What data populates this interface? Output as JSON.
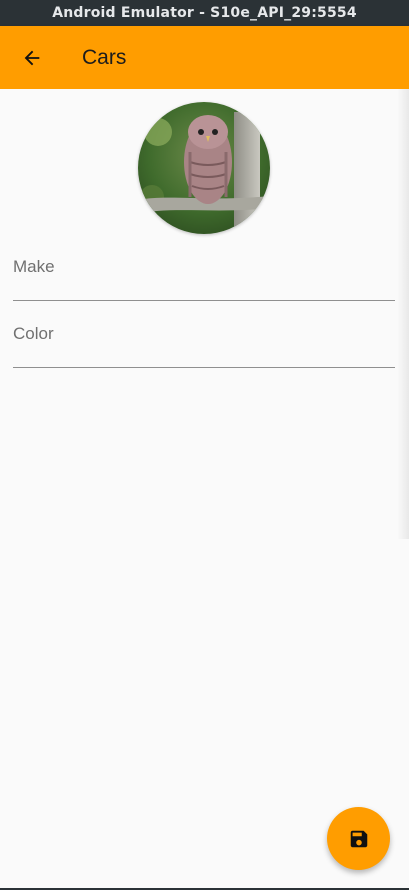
{
  "window": {
    "title": "Android Emulator - S10e_API_29:5554"
  },
  "app_bar": {
    "title": "Cars",
    "back_icon": "arrow-back-icon",
    "color": "#ff9d00"
  },
  "avatar": {
    "description": "owl-photo"
  },
  "form": {
    "make": {
      "label": "Make",
      "value": ""
    },
    "color": {
      "label": "Color",
      "value": ""
    }
  },
  "fab": {
    "icon": "save-icon",
    "color": "#ff9d00"
  }
}
